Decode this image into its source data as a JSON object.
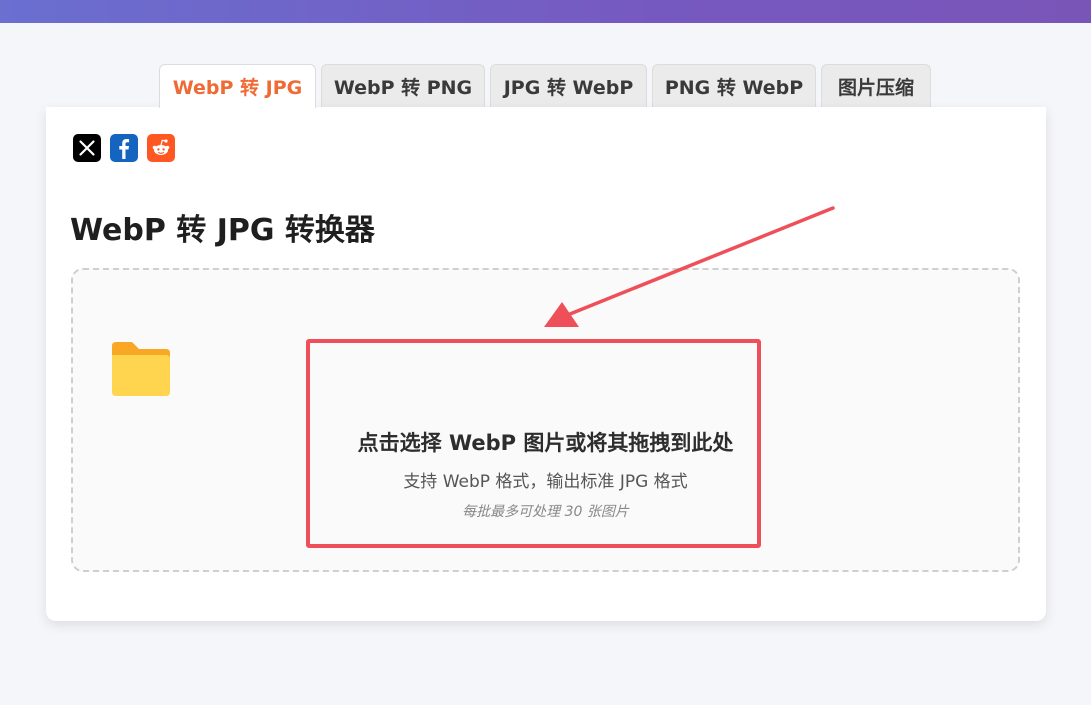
{
  "tabs": [
    {
      "label": "WebP 转 JPG",
      "active": true
    },
    {
      "label": "WebP 转 PNG",
      "active": false
    },
    {
      "label": "JPG 转 WebP",
      "active": false
    },
    {
      "label": "PNG 转 WebP",
      "active": false
    },
    {
      "label": "图片压缩",
      "active": false
    }
  ],
  "share": {
    "icons": [
      "x-icon",
      "facebook-icon",
      "reddit-icon"
    ]
  },
  "main": {
    "title": "WebP 转 JPG 转换器",
    "dropzone": {
      "icon": "folder-icon",
      "title": "点击选择 WebP 图片或将其拖拽到此处",
      "subtitle": "支持 WebP 格式，输出标准 JPG 格式",
      "limit": "每批最多可处理 30 张图片"
    }
  },
  "colors": {
    "accent": "#ef6a35",
    "header_gradient": [
      "#6a6fd0",
      "#7a55b8"
    ],
    "annotation": "#ef4f58",
    "folder": "#ffd54f"
  }
}
